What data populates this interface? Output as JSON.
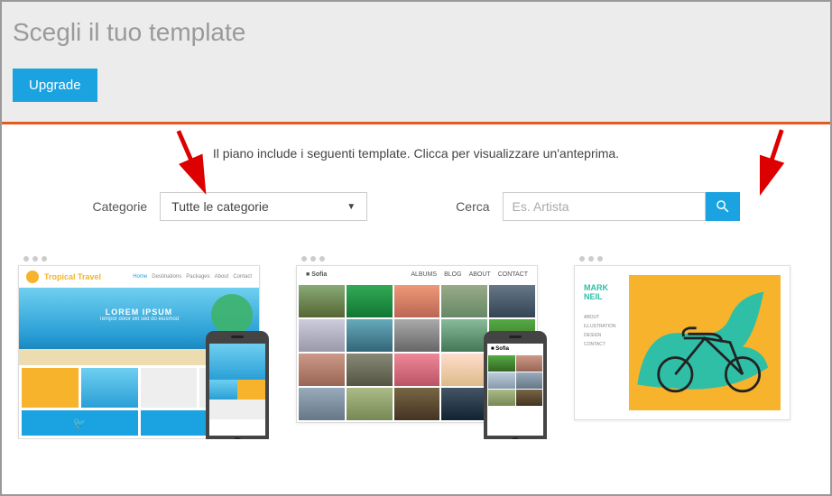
{
  "header": {
    "title": "Scegli il tuo template",
    "upgrade_label": "Upgrade"
  },
  "subtitle": "Il piano include i seguenti template. Clicca per visualizzare un'anteprima.",
  "controls": {
    "categories_label": "Categorie",
    "categories_selected": "Tutte le categorie",
    "search_label": "Cerca",
    "search_placeholder": "Es. Artista"
  },
  "templates": {
    "card1": {
      "brand": "Tropical Travel",
      "hero_title": "LOREM IPSUM",
      "hero_sub": "Tempor dolor elit sed do eiusmod"
    },
    "card2": {
      "brand": "Sofia",
      "nav_items": [
        "ALBUMS",
        "BLOG",
        "ABOUT",
        "CONTACT"
      ]
    },
    "card3": {
      "brand_line1": "MARK",
      "brand_line2": "NEIL",
      "side_items": [
        "ABOUT",
        "ILLUSTRATION",
        "DESIGN",
        "CONTACT"
      ]
    }
  }
}
